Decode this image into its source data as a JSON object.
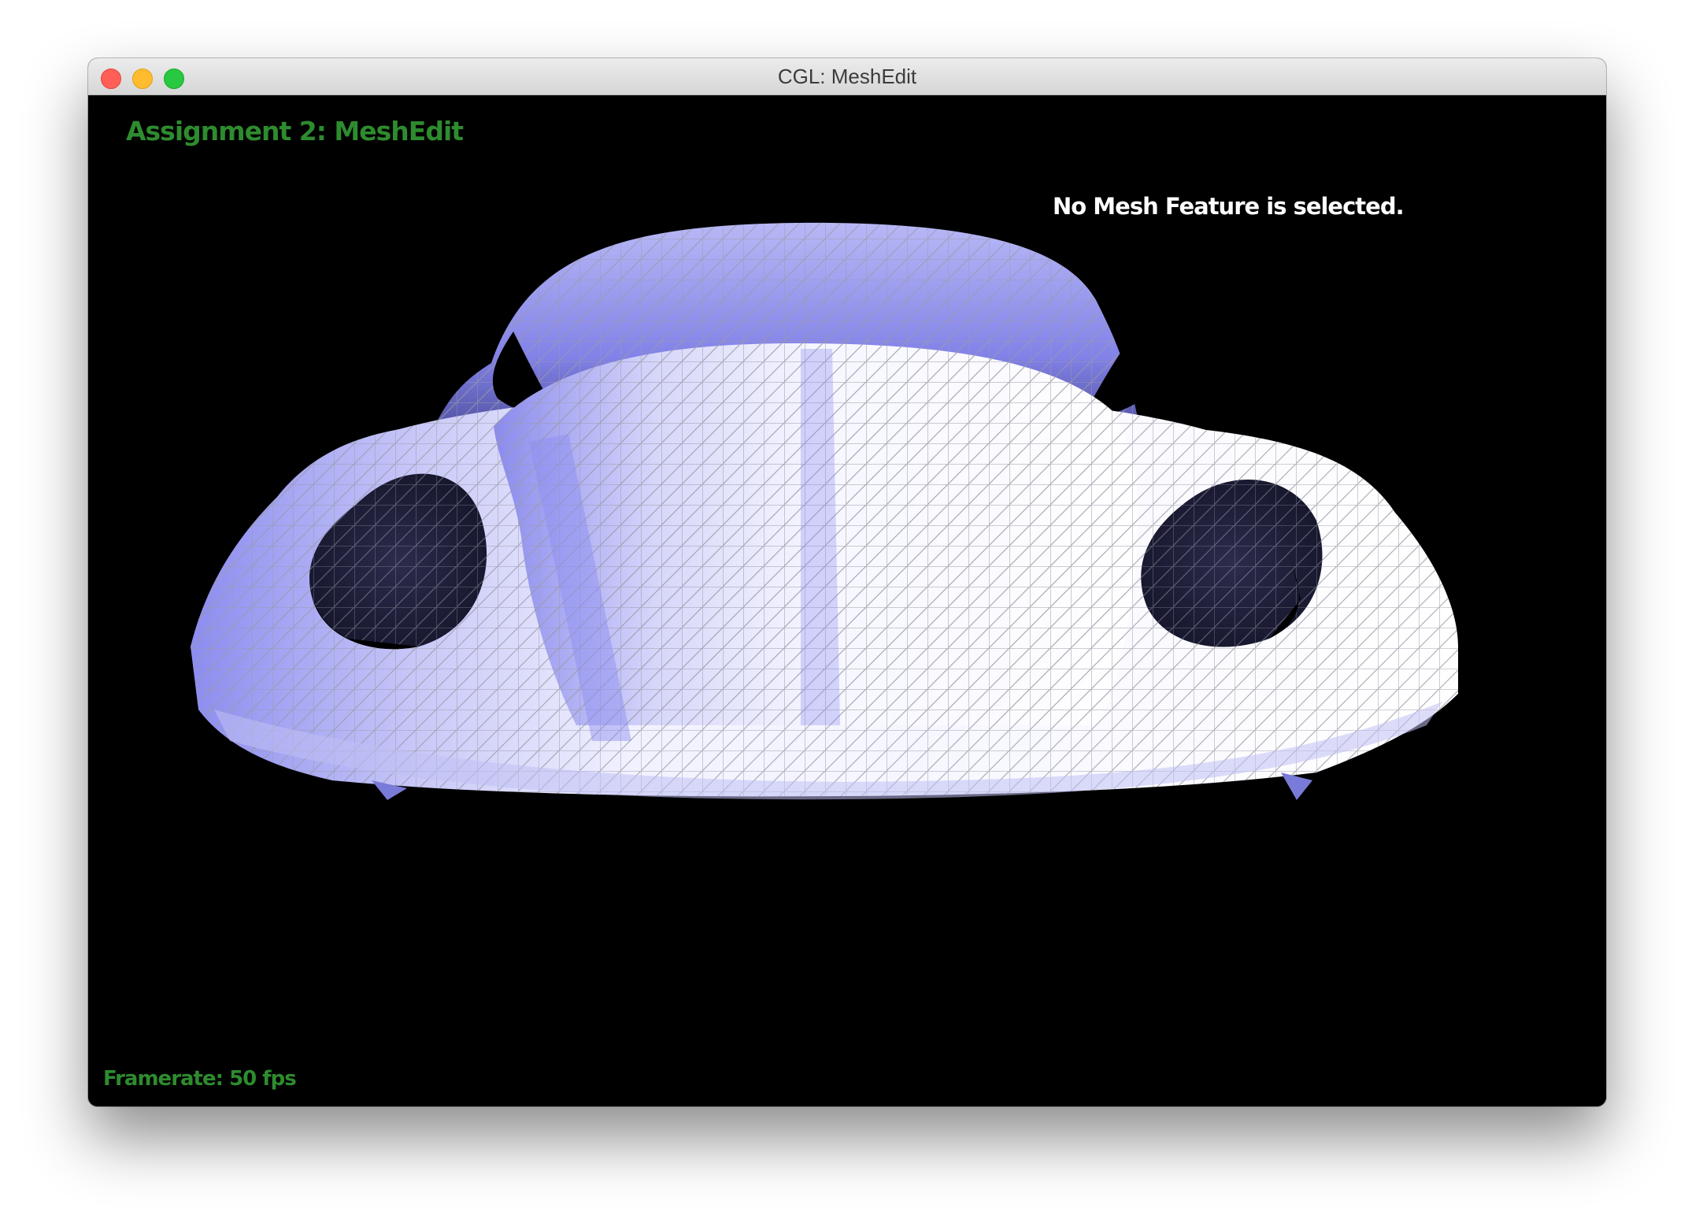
{
  "window": {
    "title": "CGL: MeshEdit"
  },
  "viewport": {
    "app_title": "Assignment 2: MeshEdit",
    "selection_status": "No Mesh Feature is selected.",
    "framerate_label": "Framerate: 50 fps"
  },
  "colors": {
    "mesh_fill_light": "#f4f4ff",
    "mesh_fill_shade": "#8c8cf0",
    "mesh_wire": "#9a9aa8",
    "hud_green": "#2e8b2e",
    "background": "#000000"
  },
  "icons": {
    "close": "close-icon",
    "minimize": "minimize-icon",
    "maximize": "maximize-icon"
  }
}
